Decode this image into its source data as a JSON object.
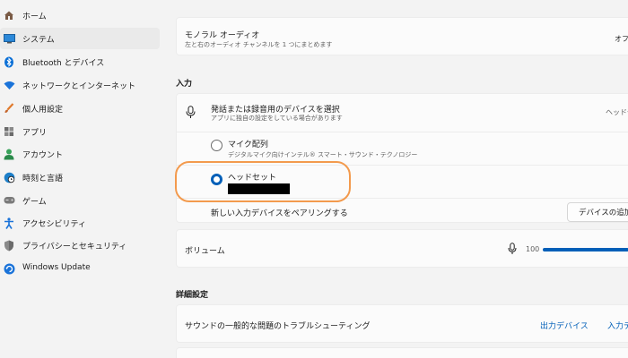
{
  "sidebar": {
    "items": [
      {
        "label": "ホーム",
        "icon": "home-icon"
      },
      {
        "label": "システム",
        "icon": "display-icon"
      },
      {
        "label": "Bluetooth とデバイス",
        "icon": "bluetooth-icon"
      },
      {
        "label": "ネットワークとインターネット",
        "icon": "wifi-icon"
      },
      {
        "label": "個人用設定",
        "icon": "brush-icon"
      },
      {
        "label": "アプリ",
        "icon": "apps-icon"
      },
      {
        "label": "アカウント",
        "icon": "person-icon"
      },
      {
        "label": "時刻と言語",
        "icon": "globe-clock-icon"
      },
      {
        "label": "ゲーム",
        "icon": "gamepad-icon"
      },
      {
        "label": "アクセシビリティ",
        "icon": "accessibility-icon"
      },
      {
        "label": "プライバシーとセキュリティ",
        "icon": "shield-icon"
      },
      {
        "label": "Windows Update",
        "icon": "update-icon"
      }
    ],
    "selected_index": 1
  },
  "mono_audio": {
    "title": "モノラル オーディオ",
    "subtitle": "左と右のオーディオ チャンネルを 1 つにまとめます",
    "toggle_label": "オフ"
  },
  "input_section": {
    "heading": "入力",
    "select_device": {
      "title": "発話または録音用のデバイスを選択",
      "subtitle": "アプリに独自の設定をしている場合があります",
      "current": "ヘッドセ"
    },
    "devices": [
      {
        "name": "マイク配列",
        "description": "デジタルマイク向けインテル® スマート・サウンド・テクノロジー",
        "checked": false
      },
      {
        "name": "ヘッドセット",
        "description": "",
        "checked": true
      }
    ],
    "pair_text": "新しい入力デバイスをペアリングする",
    "add_device_label": "デバイスの追加"
  },
  "volume": {
    "label": "ボリューム",
    "value": "100"
  },
  "advanced": {
    "heading": "詳細設定",
    "troubleshoot": "サウンドの一般的な問題のトラブルシューティング",
    "output_link": "出力デバイス",
    "input_link": "入力デ"
  },
  "colors": {
    "accent": "#005fb8",
    "highlight": "#f39a4d"
  }
}
